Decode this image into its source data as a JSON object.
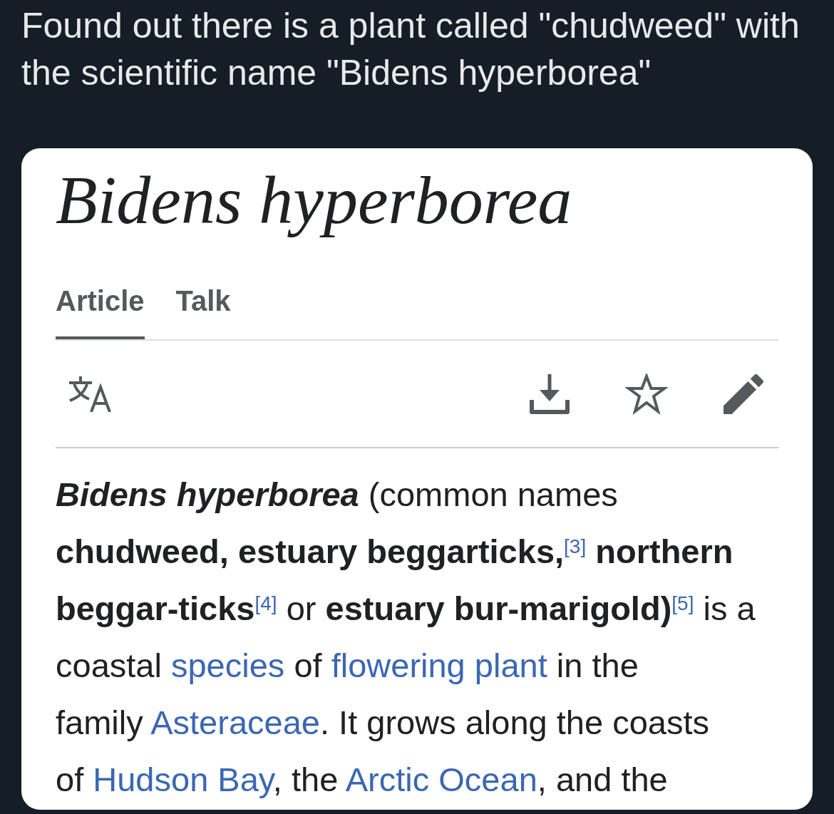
{
  "post": {
    "text": "Found out there is a plant called \"chudweed\" with the scientific name \"Bidens hyperborea\""
  },
  "article": {
    "title": "Bidens hyperborea",
    "tabs": [
      {
        "label": "Article",
        "selected": true
      },
      {
        "label": "Talk",
        "selected": false
      }
    ],
    "paragraph_lines": [
      {
        "segments": [
          {
            "kind": "bold_italic",
            "text": "Bidens hyperborea"
          },
          {
            "kind": "text",
            "text": " (common names"
          }
        ]
      },
      {
        "segments": [
          {
            "kind": "bold",
            "text": "chudweed, estuary beggarticks,"
          },
          {
            "kind": "ref",
            "text": "[3]"
          },
          {
            "kind": "bold",
            "text": " northern"
          }
        ]
      },
      {
        "segments": [
          {
            "kind": "bold",
            "text": "beggar-ticks"
          },
          {
            "kind": "ref",
            "text": "[4]"
          },
          {
            "kind": "text",
            "text": " or "
          },
          {
            "kind": "bold",
            "text": "estuary bur-marigold)"
          },
          {
            "kind": "ref",
            "text": "[5]"
          },
          {
            "kind": "text",
            "text": " is a"
          }
        ]
      },
      {
        "segments": [
          {
            "kind": "text",
            "text": "coastal "
          },
          {
            "kind": "link",
            "text": "species"
          },
          {
            "kind": "text",
            "text": " of "
          },
          {
            "kind": "link",
            "text": "flowering plant"
          },
          {
            "kind": "text",
            "text": " in the"
          }
        ]
      },
      {
        "segments": [
          {
            "kind": "text",
            "text": "family "
          },
          {
            "kind": "link",
            "text": "Asteraceae"
          },
          {
            "kind": "text",
            "text": ". It grows along the coasts"
          }
        ]
      },
      {
        "segments": [
          {
            "kind": "text",
            "text": "of "
          },
          {
            "kind": "link",
            "text": "Hudson Bay"
          },
          {
            "kind": "text",
            "text": ", the "
          },
          {
            "kind": "link",
            "text": "Arctic Ocean"
          },
          {
            "kind": "text",
            "text": ", and the"
          }
        ]
      }
    ]
  }
}
